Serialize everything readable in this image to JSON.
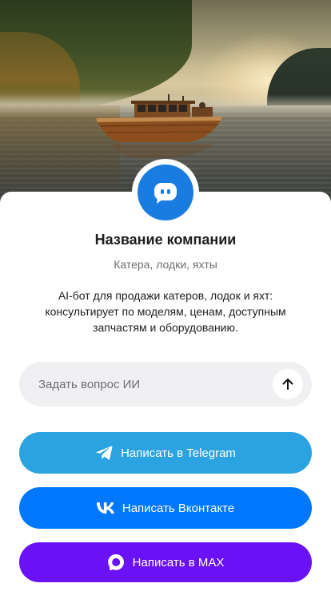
{
  "colors": {
    "avatar_bg": "#1a7ce0",
    "telegram": "#2aa3e0",
    "vkontakte": "#0077ff",
    "max": "#6a11f5",
    "input_bg": "#f0f0f2",
    "title_text": "#1d1d1f",
    "muted_text": "#6e6e73"
  },
  "hero": {
    "icon": "boat-on-lake-photo"
  },
  "profile": {
    "avatar_icon": "chat-bot-icon",
    "company_name": "Название компании",
    "subtitle": "Катера, лодки, яхты",
    "description": "AI-бот для продажи катеров, лодок и яхт: консультирует по моделям, ценам, доступным запчастям и оборудованию."
  },
  "ask": {
    "placeholder": "Задать вопрос ИИ",
    "value": "",
    "send_icon": "arrow-up-icon"
  },
  "buttons": {
    "telegram": {
      "label": "Написать в Telegram",
      "icon": "telegram-icon"
    },
    "vkontakte": {
      "label": "Написать Вконтакте",
      "icon": "vk-icon"
    },
    "max": {
      "label": "Написать в MAX",
      "icon": "max-icon"
    }
  }
}
